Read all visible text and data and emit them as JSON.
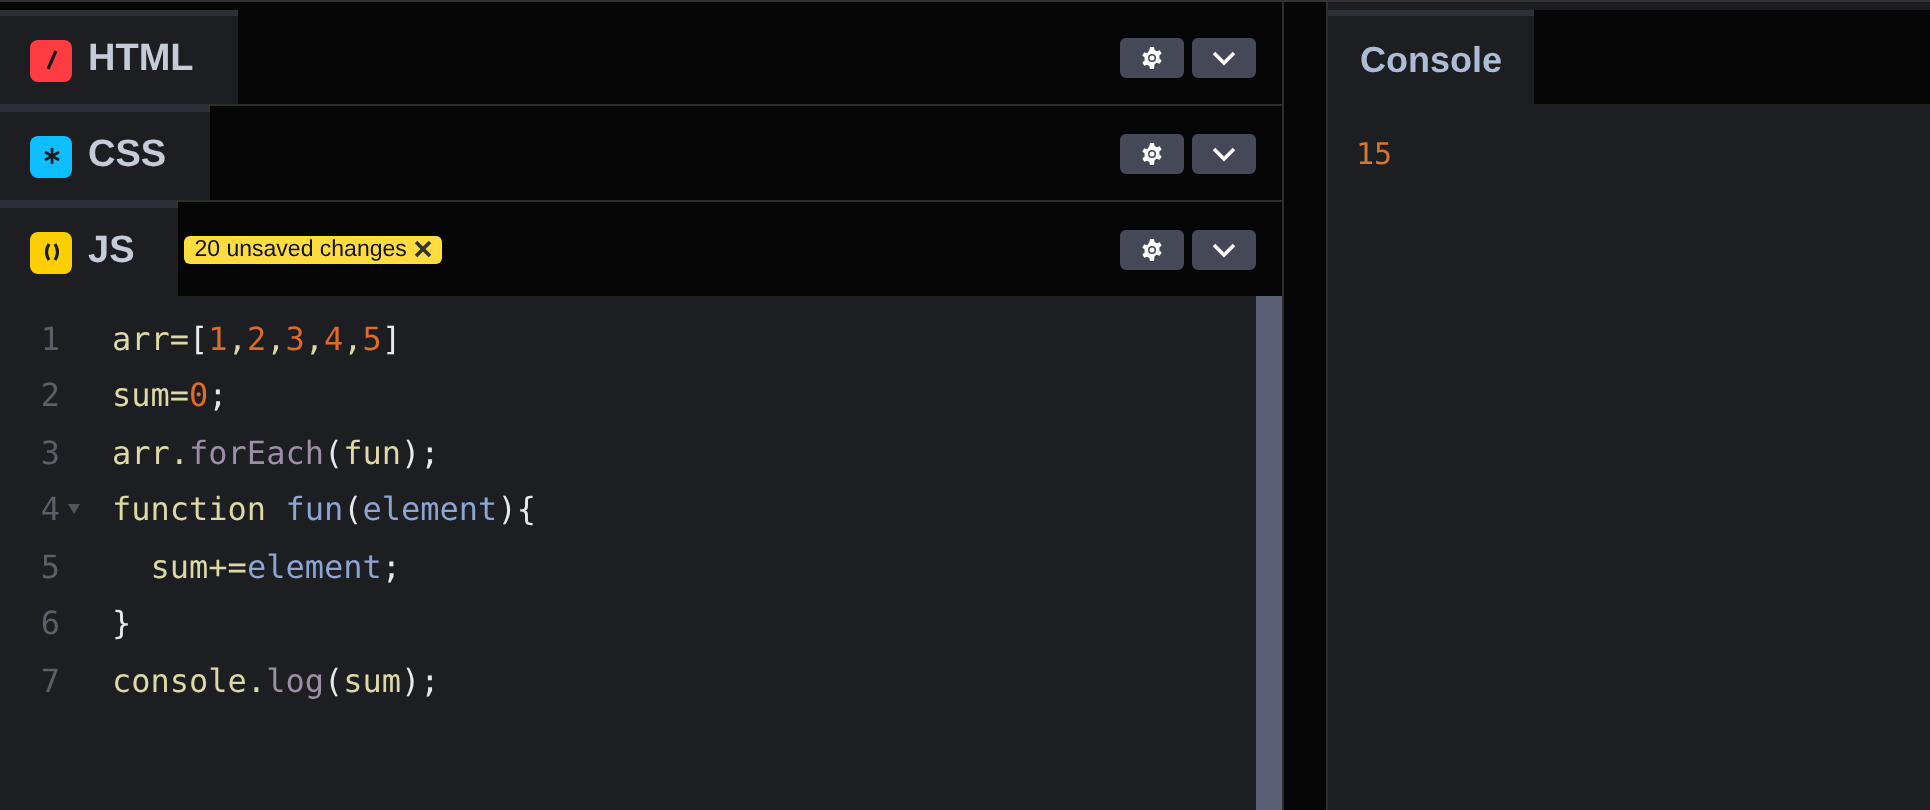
{
  "editors": [
    {
      "kind": "html",
      "label": "HTML"
    },
    {
      "kind": "css",
      "label": "CSS"
    },
    {
      "kind": "js",
      "label": "JS",
      "badge": "20 unsaved changes"
    }
  ],
  "code": {
    "lines": [
      {
        "number": "1",
        "foldable": false,
        "tokens": [
          {
            "kind": "text",
            "text": "arr="
          },
          {
            "kind": "punct",
            "text": "["
          },
          {
            "kind": "num",
            "text": "1"
          },
          {
            "kind": "text",
            "text": ","
          },
          {
            "kind": "num",
            "text": "2"
          },
          {
            "kind": "text",
            "text": ","
          },
          {
            "kind": "num",
            "text": "3"
          },
          {
            "kind": "text",
            "text": ","
          },
          {
            "kind": "num",
            "text": "4"
          },
          {
            "kind": "text",
            "text": ","
          },
          {
            "kind": "num",
            "text": "5"
          },
          {
            "kind": "punct",
            "text": "]"
          }
        ]
      },
      {
        "number": "2",
        "foldable": false,
        "tokens": [
          {
            "kind": "text",
            "text": "sum="
          },
          {
            "kind": "num",
            "text": "0"
          },
          {
            "kind": "punct",
            "text": ";"
          }
        ]
      },
      {
        "number": "3",
        "foldable": false,
        "tokens": [
          {
            "kind": "text",
            "text": "arr."
          },
          {
            "kind": "prop",
            "text": "forEach"
          },
          {
            "kind": "punct",
            "text": "("
          },
          {
            "kind": "text",
            "text": "fun"
          },
          {
            "kind": "punct",
            "text": ");"
          }
        ]
      },
      {
        "number": "4",
        "foldable": true,
        "tokens": [
          {
            "kind": "text",
            "text": "function "
          },
          {
            "kind": "name",
            "text": "fun"
          },
          {
            "kind": "punct",
            "text": "("
          },
          {
            "kind": "name",
            "text": "element"
          },
          {
            "kind": "punct",
            "text": "){"
          }
        ]
      },
      {
        "number": "5",
        "foldable": false,
        "tokens": [
          {
            "kind": "text",
            "text": "  sum+="
          },
          {
            "kind": "name",
            "text": "element"
          },
          {
            "kind": "punct",
            "text": ";"
          }
        ]
      },
      {
        "number": "6",
        "foldable": false,
        "tokens": [
          {
            "kind": "punct",
            "text": "}"
          }
        ]
      },
      {
        "number": "7",
        "foldable": false,
        "tokens": [
          {
            "kind": "text",
            "text": "console."
          },
          {
            "kind": "prop",
            "text": "log"
          },
          {
            "kind": "punct",
            "text": "("
          },
          {
            "kind": "text",
            "text": "sum"
          },
          {
            "kind": "punct",
            "text": ");"
          }
        ]
      }
    ]
  },
  "console": {
    "title": "Console",
    "output": [
      "15"
    ]
  }
}
